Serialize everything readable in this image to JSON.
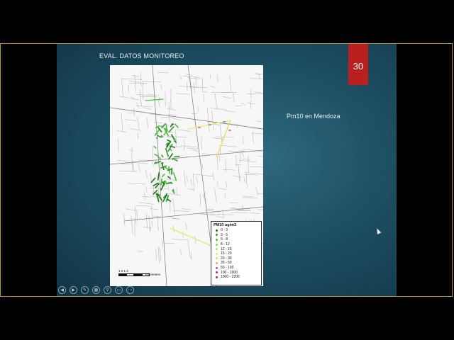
{
  "slide": {
    "title": "EVAL. DATOS MONITOREO",
    "page_number": "30",
    "caption": "Pm10 en Mendoza"
  },
  "map": {
    "legend_title": "PM10 ug/m3",
    "legend": [
      {
        "label": "0 - 3",
        "color": "#1a7a1a"
      },
      {
        "label": "3 - 5",
        "color": "#2a9a2a"
      },
      {
        "label": "5 - 8",
        "color": "#4cbf3c"
      },
      {
        "label": "8 - 12",
        "color": "#7fd35a"
      },
      {
        "label": "12 - 15",
        "color": "#b8e35a"
      },
      {
        "label": "15 - 20",
        "color": "#e4ee6a"
      },
      {
        "label": "20 - 30",
        "color": "#f0d85a"
      },
      {
        "label": "30 - 50",
        "color": "#e8b84a"
      },
      {
        "label": "50 - 100",
        "color": "#c846c8"
      },
      {
        "label": "100 - 1000",
        "color": "#a02ab0"
      },
      {
        "label": "1000 - 2200",
        "color": "#d0202a"
      }
    ],
    "scale_ticks": "1  0    1    2",
    "scale_unit": "Kilometers"
  },
  "controls": [
    {
      "name": "prev-slide-button",
      "glyph": "◀"
    },
    {
      "name": "next-slide-button",
      "glyph": "▶"
    },
    {
      "name": "pen-tool-button",
      "glyph": "✎"
    },
    {
      "name": "slides-grid-button",
      "glyph": "▦"
    },
    {
      "name": "zoom-button",
      "glyph": "⚲"
    },
    {
      "name": "subtitles-button",
      "glyph": "▭"
    },
    {
      "name": "more-options-button",
      "glyph": "⋯"
    }
  ],
  "colors": {
    "badge": "#b9201f",
    "frame_border": "#b49a2a"
  }
}
